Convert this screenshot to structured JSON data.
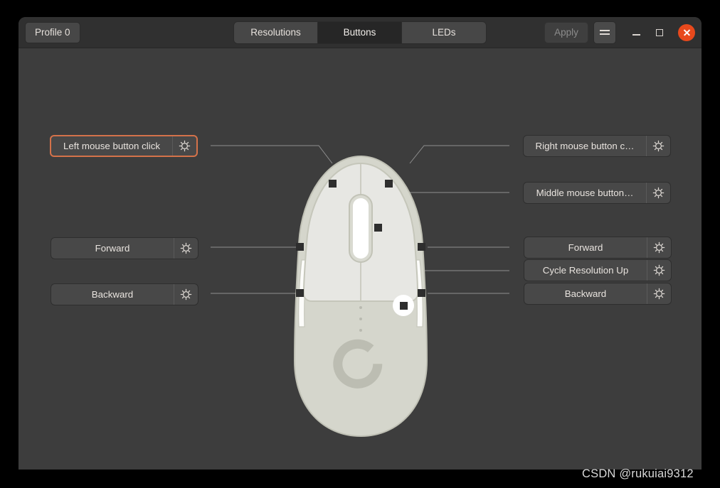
{
  "window": {
    "profile_label": "Profile 0",
    "apply_label": "Apply",
    "menu_icon": "hamburger-menu-icon",
    "minimize_icon": "minimize-icon",
    "maximize_icon": "maximize-icon",
    "close_icon": "close-icon",
    "close_color": "#e8491c"
  },
  "tabs": [
    {
      "label": "Resolutions",
      "active": false
    },
    {
      "label": "Buttons",
      "active": true
    },
    {
      "label": "LEDs",
      "active": false
    }
  ],
  "theme": {
    "background": "#3d3d3d",
    "headerbar": "#303030",
    "button": "#484848",
    "focus_accent": "#d4724a",
    "text": "#e9e4df"
  },
  "left_buttons": [
    {
      "label": "Left mouse button click",
      "gear_icon": "gear-icon",
      "focused": true
    },
    {
      "label": "Forward",
      "gear_icon": "gear-icon",
      "focused": false
    },
    {
      "label": "Backward",
      "gear_icon": "gear-icon",
      "focused": false
    }
  ],
  "right_buttons": [
    {
      "label": "Right mouse button c…",
      "gear_icon": "gear-icon",
      "focused": false
    },
    {
      "label": "Middle mouse button…",
      "gear_icon": "gear-icon",
      "focused": false
    },
    {
      "label": "Forward",
      "gear_icon": "gear-icon",
      "focused": false
    },
    {
      "label": "Cycle Resolution Up",
      "gear_icon": "gear-icon",
      "focused": false
    },
    {
      "label": "Backward",
      "gear_icon": "gear-icon",
      "focused": false
    }
  ],
  "mouse_diagram": {
    "device_icon": "gaming-mouse-illustration",
    "logo_icon": "g-logo-icon",
    "markers": [
      "left-click-marker",
      "right-click-marker",
      "scroll-wheel-marker",
      "side-forward-marker",
      "side-backward-marker",
      "right-forward-marker",
      "right-backward-marker",
      "dpi-button-marker"
    ]
  },
  "watermark": {
    "text": "CSDN @rukuiai9312"
  }
}
